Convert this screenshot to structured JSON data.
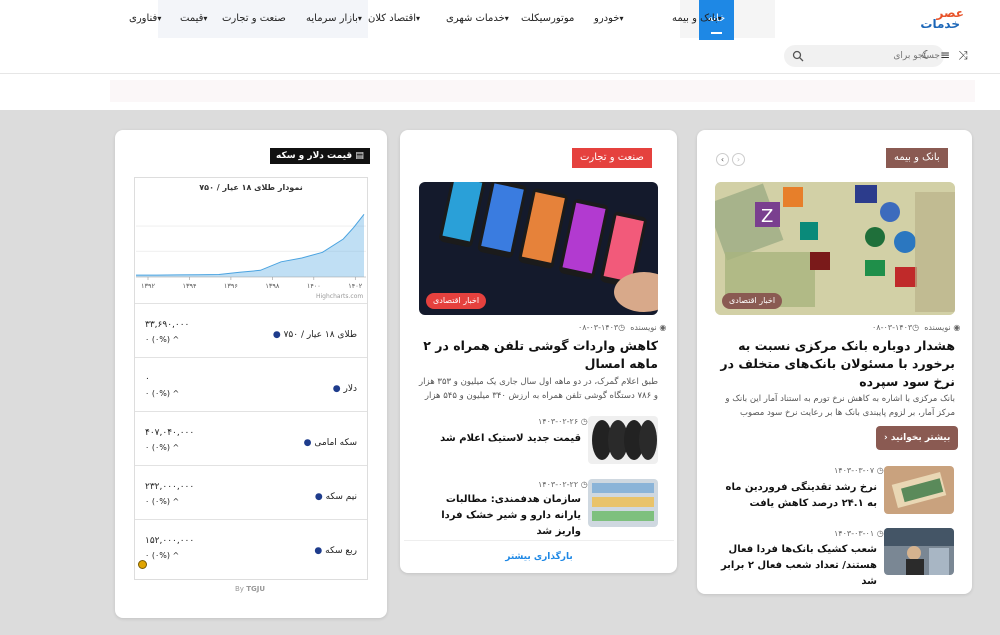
{
  "header": {
    "logo_line1": "عصر",
    "logo_line2": "خدمات",
    "nav": [
      {
        "label": "خانه",
        "active": true
      },
      {
        "label": "بانک و بیمه",
        "dropdown": true
      },
      {
        "label": "خودرو",
        "dropdown": true
      },
      {
        "label": "موتورسیکلت"
      },
      {
        "label": "خدمات شهری",
        "dropdown": true
      },
      {
        "label": "اقتصاد کلان",
        "dropdown": true
      },
      {
        "label": "بازار سرمایه",
        "dropdown": true
      },
      {
        "label": "صنعت و تجارت"
      },
      {
        "label": "قیمت",
        "dropdown": true
      },
      {
        "label": "فناوری",
        "dropdown": true
      }
    ],
    "search_placeholder": "جستجو برای",
    "tools": [
      "moon-icon",
      "menu-icon",
      "shuffle-icon"
    ]
  },
  "bank_section": {
    "tag": "بانک و بیمه",
    "tag_color": "#8a5a52",
    "category": "اخبار اقتصادی",
    "author": "نویسنده",
    "date": "۱۴۰۳-۰۳-۰۸",
    "title": "هشدار دوباره بانک مرکزی نسبت به برخورد با مسئولان بانک‌های متخلف در نرخ سود سپرده",
    "excerpt": "بانک مرکزی با اشاره به کاهش نرخ تورم به استناد آمار این بانک و مرکز آمار، بر لزوم پایبندی بانک ها بر رعایت نرخ سود مصوب",
    "more": "بیشتر بخوانید",
    "items": [
      {
        "date": "۱۴۰۳-۰۳-۰۷",
        "title": "نرخ رشد تقدینگی فروردین ماه به ۲۴.۱ درصد کاهش یافت"
      },
      {
        "date": "۱۴۰۳-۰۳-۰۱",
        "title": "شعب کشیک بانک‌ها فردا فعال هستند/ تعداد شعب فعال ۲ برابر شد"
      }
    ]
  },
  "industry_section": {
    "tag": "صنعت و تجارت",
    "tag_color": "#e5413e",
    "category": "اخبار اقتصادی",
    "author": "نویسنده",
    "date": "۱۴۰۳-۰۳-۰۸",
    "title": "کاهش واردات گوشی تلفن همراه در ۲ ماهه امسال",
    "excerpt": "طبق اعلام گمرک، در دو ماهه اول سال جاری یک میلیون و ۳۵۳ هزار و ۷۸۶ دستگاه گوشی تلفن همراه به ارزش ۳۴۰ میلیون و ۵۴۵ هزار",
    "items": [
      {
        "date": "۱۴۰۳-۰۲-۲۶",
        "title": "قیمت جدید لاستیک اعلام شد"
      },
      {
        "date": "۱۴۰۳-۰۲-۲۲",
        "title": "سازمان هدفمندی: مطالبات یارانه دارو و شیر خشک فردا واریز شد"
      }
    ],
    "load_more": "بارگذاری بیشتر"
  },
  "price_widget": {
    "title": "قیمت دلار و سکه",
    "chart_credit": "Highcharts.com",
    "by": "By",
    "by_brand": "TGJU",
    "rows": [
      {
        "name": "طلای ۱۸ عیار / ۷۵۰",
        "value": "۳۳,۶۹۰,۰۰۰",
        "change": "۰ (۰%)"
      },
      {
        "name": "دلار",
        "value": "۰",
        "change": "۰ (۰%)"
      },
      {
        "name": "سکه امامی",
        "value": "۴۰۷,۰۴۰,۰۰۰",
        "change": "۰ (۰%)"
      },
      {
        "name": "نیم سکه",
        "value": "۲۳۲,۰۰۰,۰۰۰",
        "change": "۰ (۰%)"
      },
      {
        "name": "ربع سکه",
        "value": "۱۵۲,۰۰۰,۰۰۰",
        "change": "۰ (۰%)"
      }
    ]
  },
  "chart_data": {
    "type": "area",
    "title": "نمودار طلای ۱۸ عیار / ۷۵۰",
    "xlabel": "",
    "ylabel": "",
    "x_tick_labels": [
      "۱۳۹۲",
      "۱۳۹۴",
      "۱۳۹۶",
      "۱۳۹۸",
      "۱۴۰۰",
      "۱۴۰۲"
    ],
    "x": [
      1392,
      1393,
      1394,
      1395,
      1396,
      1397,
      1398,
      1399,
      1400,
      1401,
      1402,
      1402.5,
      1403
    ],
    "values": [
      1,
      1,
      1.1,
      1.2,
      1.3,
      2.5,
      3.5,
      8,
      10,
      13,
      20,
      26,
      33
    ],
    "ylim": [
      0,
      40
    ],
    "grid": true,
    "color": "#4aa3e0"
  }
}
